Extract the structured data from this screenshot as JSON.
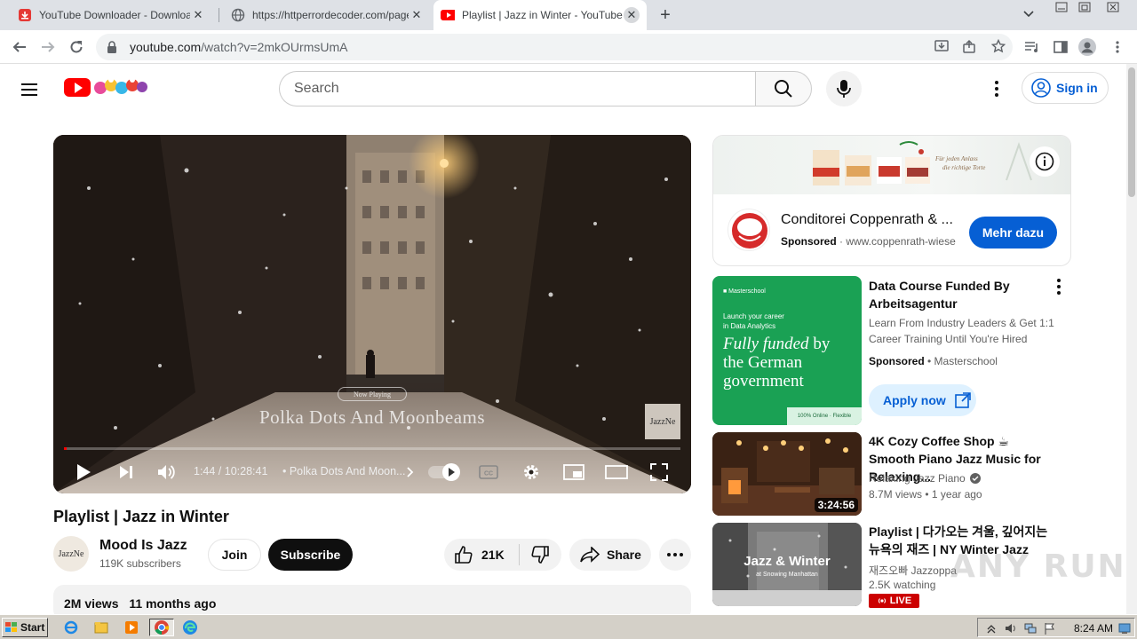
{
  "browser": {
    "tabs": [
      {
        "title": "YouTube Downloader - Download Yo",
        "close": "✕"
      },
      {
        "title": "https://httperrordecoder.com/page/",
        "close": "✕"
      },
      {
        "title": "Playlist | Jazz in Winter - YouTube",
        "close": "✕"
      }
    ],
    "url_host": "youtube.com",
    "url_path": "/watch?v=2mkOUrmsUmA"
  },
  "header": {
    "search_placeholder": "Search",
    "signin_label": "Sign in"
  },
  "player": {
    "now_playing_label": "Now Playing",
    "song_overlay": "Polka Dots And Moonbeams",
    "watermark_badge": "JazzNe",
    "time": "1:44 / 10:28:41",
    "chapter": "• Polka Dots And Moon...",
    "progress": 0.0028
  },
  "video": {
    "title": "Playlist | Jazz in Winter",
    "channel_name": "Mood Is Jazz",
    "channel_avatar_text": "JazzNe",
    "subscribers": "119K subscribers",
    "join_label": "Join",
    "subscribe_label": "Subscribe",
    "likes": "21K",
    "share_label": "Share",
    "views": "2M views",
    "age": "11 months ago"
  },
  "ad1": {
    "title": "Conditorei Coppenrath & ...",
    "sponsored": "Sponsored",
    "url": "www.coppenrath-wiese",
    "cta": "Mehr dazu"
  },
  "ad2": {
    "thumb_brand": "■ Masterschool",
    "thumb_tag_line1": "Launch your career",
    "thumb_tag_line2": "in Data Analytics",
    "thumb_head_1": "Fully funded",
    "thumb_head_2": " by",
    "thumb_head_3": "the German",
    "thumb_head_4": "government",
    "thumb_chip": "100% Online · Flexible",
    "title": "Data Course Funded By Arbeitsagentur",
    "desc": "Learn From Industry Leaders & Get 1:1 Career Training Until You're Hired",
    "sponsored": "Sponsored",
    "advertiser": "• Masterschool",
    "cta": "Apply now"
  },
  "recommendations": [
    {
      "title": "4K Cozy Coffee Shop ☕ Smooth Piano Jazz Music for Relaxing...",
      "channel": "Relaxing Jazz Piano",
      "meta": "8.7M views  • 1 year ago",
      "duration": "3:24:56"
    },
    {
      "title": "Playlist | 다가오는 겨울, 깊어지는 뉴욕의 재즈 | NY Winter Jazz",
      "channel": "재즈오빠 Jazzoppa",
      "meta": "2.5K watching",
      "thumb_line1": "Jazz & Winter",
      "thumb_line2": "at Snowing Manhattan",
      "badge": "LIVE"
    }
  ],
  "taskbar": {
    "start_label": "Start",
    "clock": "8:24 AM"
  },
  "overlay_watermark": "ANY RUN",
  "colors": {
    "youtube_red": "#ff0000",
    "link_blue": "#065fd4",
    "masterschool_green": "#1aa154"
  }
}
